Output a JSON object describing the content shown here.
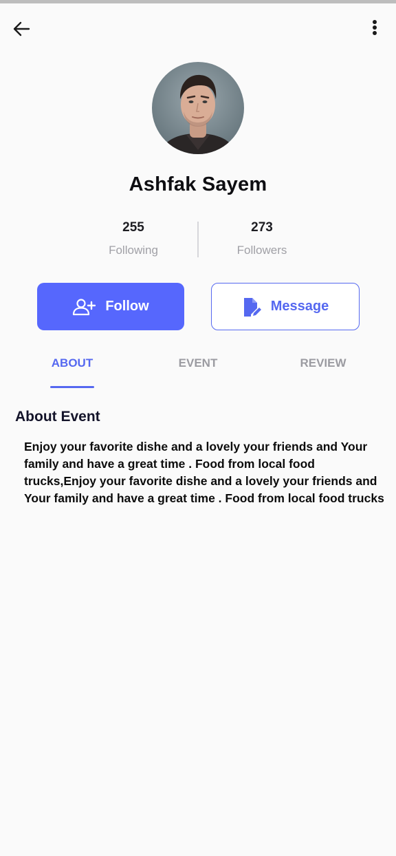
{
  "profile": {
    "name": "Ashfak Sayem",
    "following_count": "255",
    "following_label": "Following",
    "followers_count": "273",
    "followers_label": "Followers"
  },
  "actions": {
    "follow_label": "Follow",
    "message_label": "Message"
  },
  "tabs": [
    {
      "label": "ABOUT",
      "active": true
    },
    {
      "label": "EVENT",
      "active": false
    },
    {
      "label": "REVIEW",
      "active": false
    }
  ],
  "about": {
    "title": "About Event",
    "body": "Enjoy your favorite dishe and a lovely your friends and Your family and have a great time . Food from local food trucks,Enjoy your favorite dishe and a lovely your friends and Your family and have a great time . Food from local food trucks"
  },
  "icons": {
    "back": "arrow-left-icon",
    "more": "more-vertical-icon",
    "follow": "add-user-icon",
    "message": "edit-document-icon"
  },
  "colors": {
    "accent": "#5568f0",
    "follow_button": "#5667fd",
    "muted_text": "#9b9ba1",
    "background": "#fafafa"
  }
}
